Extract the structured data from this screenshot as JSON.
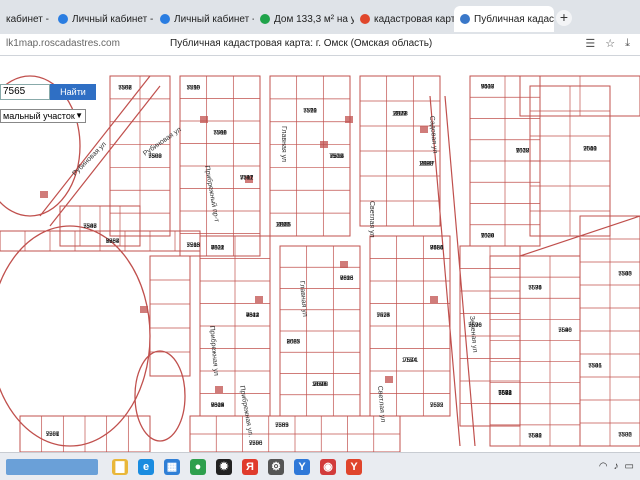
{
  "browser": {
    "tabs": [
      {
        "label": "кабинет - ",
        "color": "#2a7de1"
      },
      {
        "label": "Личный кабинет - ",
        "color": "#2a7de1"
      },
      {
        "label": "Личный кабинет - ",
        "color": "#2a7de1"
      },
      {
        "label": "Дом 133,3 м² на ул",
        "color": "#1fa34a"
      },
      {
        "label": "кадастровая карта",
        "color": "#e0472c"
      },
      {
        "label": "Публичная кадастр",
        "color": "#3a78c9",
        "active": true
      }
    ],
    "new_tab": "+",
    "url": "lk1map.roscadastres.com",
    "page_title": "Публичная кадастровая карта: г. Омск (Омская область)"
  },
  "map_ui": {
    "search_value": "7565",
    "find_label": "Найти",
    "select_value": "мальный участок"
  },
  "streets": [
    "Рубиновая ул",
    "Рубиновая ул",
    "Прибрежный пр-т",
    "Прибрежная ул.",
    "Главная ул",
    "Главная ул",
    "Прибрежная ул",
    "Светлая ул",
    "Светлая ул",
    "Зеленая ул",
    "Садовая ул"
  ],
  "parcels": [
    "7506",
    "7508",
    "7510",
    "7509",
    "7511",
    "7513",
    "7512",
    "75/14",
    "11165",
    "11168",
    "11167",
    "7517",
    "7518",
    "7520",
    "7519",
    "7521",
    "7522",
    "7524",
    "7526",
    "7527",
    "7528",
    "7523",
    "7525",
    "7534",
    "7532",
    "7536",
    "7538",
    "7535",
    "7540",
    "7542",
    "7544",
    "7545",
    "7541",
    "7530",
    "7546",
    "8857",
    "7553",
    "7555",
    "7556",
    "7557",
    "7558",
    "7559",
    "7560",
    "7561",
    "7565",
    "7570",
    "7571",
    "7566",
    "7577",
    "8998",
    "9007",
    "9018",
    "9000",
    "9001",
    "9002",
    "9011",
    "9009",
    "9013",
    "9005",
    "9004",
    "7564",
    "7573",
    "7574",
    "7575",
    "7576",
    "7578",
    "7579",
    "7580",
    "7581",
    "7582",
    "7583",
    "7586",
    "7585",
    "7587",
    "7588",
    "7589",
    "7590",
    "7591",
    "7592",
    "7593",
    "7595",
    "7596",
    "7597",
    "7598",
    "7599",
    "7600",
    "7601",
    "7603",
    "7605",
    "7606",
    "7607",
    "7608",
    "7610",
    "7611",
    "7612",
    "7613",
    "7615",
    "8555",
    "10303",
    "9486",
    "9494",
    "10301",
    "5602",
    "5690",
    "5692",
    "5694",
    "5696",
    "5698",
    "5699",
    "5700",
    "5701",
    "5702",
    "5703",
    "5704",
    "5705",
    "5706",
    "5707",
    "5708",
    "5709",
    "5710",
    "5711",
    "5712",
    "5713",
    "5714",
    "5715",
    "8970",
    "8979",
    "8183",
    "5433",
    "1678",
    "1674",
    "2540",
    "4828",
    "4844",
    "6895",
    "6896",
    "2083",
    "2075",
    "8956"
  ],
  "taskbar": {
    "icons": [
      {
        "name": "folder-icon",
        "glyph": "▇",
        "color": "#e9b73a"
      },
      {
        "name": "edge-icon",
        "glyph": "e",
        "color": "#1a8ce0"
      },
      {
        "name": "windows-icon",
        "glyph": "▦",
        "color": "#2f7fd6"
      },
      {
        "name": "chrome-icon",
        "glyph": "●",
        "color": "#2e9f4d"
      },
      {
        "name": "bee-icon",
        "glyph": "✹",
        "color": "#222"
      },
      {
        "name": "yandex-icon",
        "glyph": "Я",
        "color": "#e03b2c"
      },
      {
        "name": "settings-icon",
        "glyph": "⚙",
        "color": "#555"
      },
      {
        "name": "yandex-browser-icon",
        "glyph": "Y",
        "color": "#2f78d8"
      },
      {
        "name": "chrome-alt-icon",
        "glyph": "◉",
        "color": "#d23b3b"
      },
      {
        "name": "yandex-browser-active-icon",
        "glyph": "Y",
        "color": "#e0452c"
      }
    ]
  }
}
